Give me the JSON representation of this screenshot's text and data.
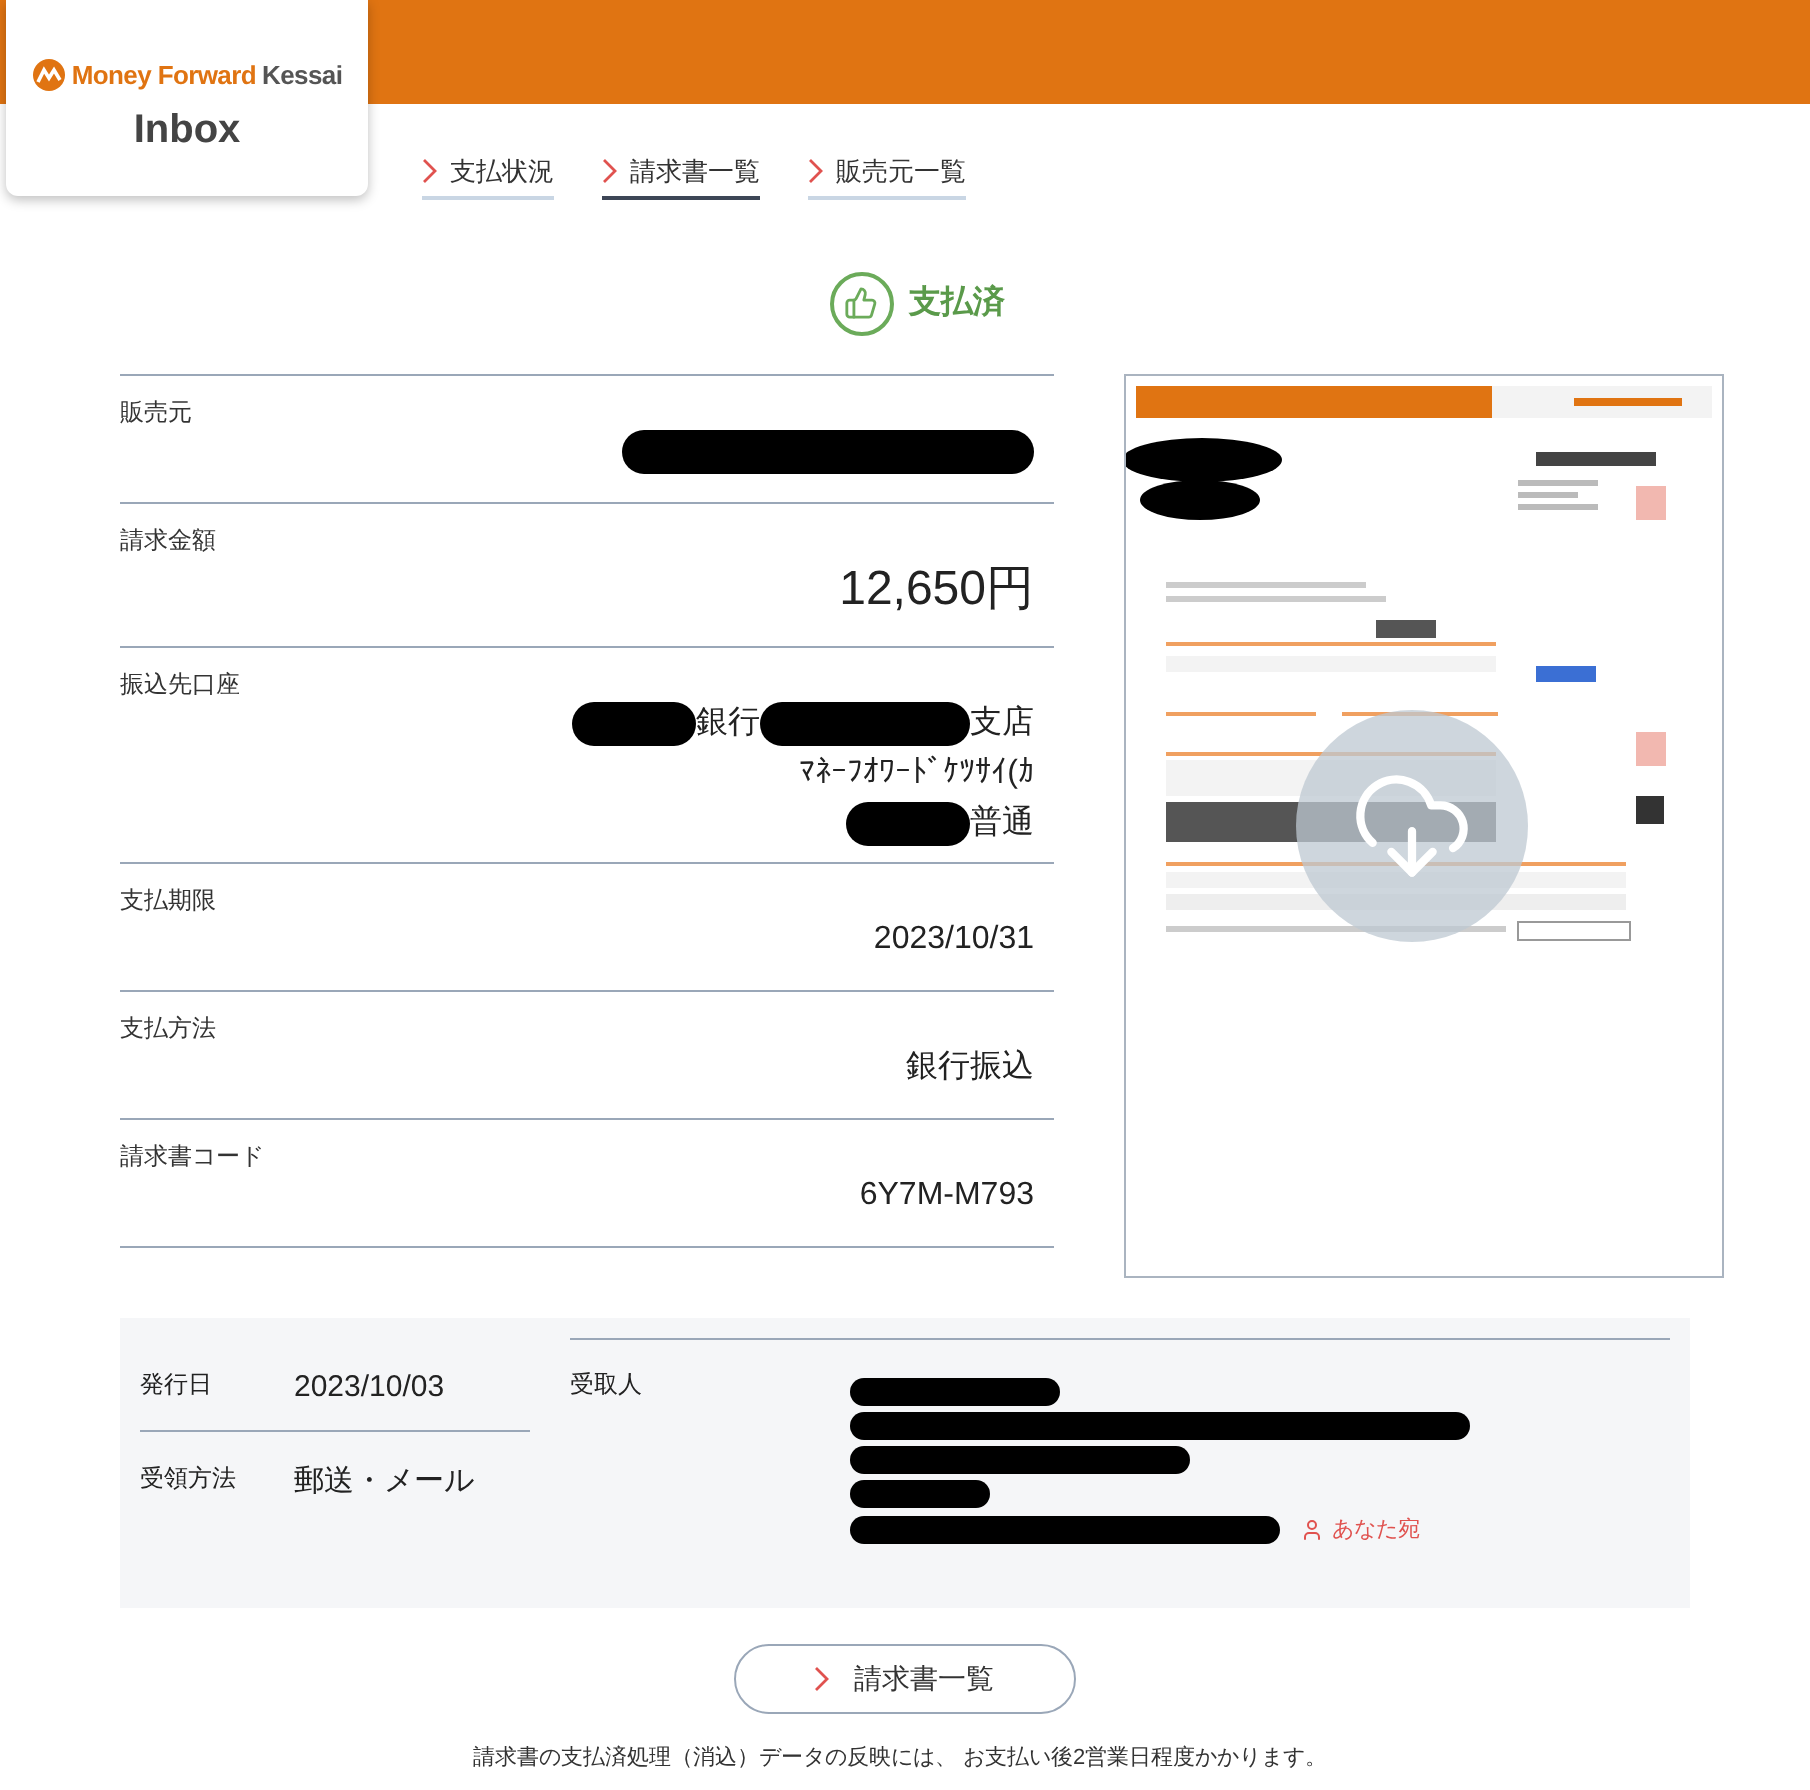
{
  "header": {
    "brand": "Money Forward",
    "brand_suffix": "Kessai",
    "app": "Inbox"
  },
  "nav": [
    {
      "label": "支払状況",
      "selected": false
    },
    {
      "label": "請求書一覧",
      "selected": true
    },
    {
      "label": "販売元一覧",
      "selected": false
    }
  ],
  "status": {
    "label": "支払済"
  },
  "fields": [
    {
      "label": "販売元",
      "large": false,
      "lines": [
        [
          {
            "kind": "redacted"
          }
        ]
      ]
    },
    {
      "label": "請求金額",
      "large": true,
      "lines": [
        [
          {
            "kind": "text",
            "text": "12,650円"
          }
        ]
      ]
    },
    {
      "label": "振込先口座",
      "large": false,
      "lines": [
        [
          {
            "kind": "redacted"
          },
          {
            "kind": "text",
            "text": "銀行"
          },
          {
            "kind": "redacted"
          },
          {
            "kind": "text",
            "text": "支店"
          }
        ],
        [
          {
            "kind": "text",
            "text": "ﾏﾈｰﾌｵﾜｰﾄﾞｹﾂｻｲ(ｶ"
          }
        ],
        [
          {
            "kind": "redacted"
          },
          {
            "kind": "text",
            "text": "普通"
          }
        ]
      ]
    },
    {
      "label": "支払期限",
      "large": false,
      "lines": [
        [
          {
            "kind": "text",
            "text": "2023/10/31"
          }
        ]
      ]
    },
    {
      "label": "支払方法",
      "large": false,
      "lines": [
        [
          {
            "kind": "text",
            "text": "銀行振込"
          }
        ]
      ]
    },
    {
      "label": "請求書コード",
      "large": false,
      "lines": [
        [
          {
            "kind": "text",
            "text": "6Y7M-M793"
          }
        ]
      ]
    }
  ],
  "details": [
    {
      "label": "発行日",
      "value": "2023/10/03"
    },
    {
      "label": "受領方法",
      "value": "郵送・メール"
    }
  ],
  "recipient": {
    "label": "受取人",
    "lines": [
      {
        "kind": "redacted"
      },
      {
        "kind": "redacted"
      },
      {
        "kind": "redacted"
      },
      {
        "kind": "redacted"
      },
      {
        "kind": "redacted",
        "badge": "あなた宛"
      }
    ]
  },
  "back_button": {
    "label": "請求書一覧"
  },
  "note": "請求書の支払済処理（消込）データの反映には、 お支払い後2営業日程度かかります。"
}
